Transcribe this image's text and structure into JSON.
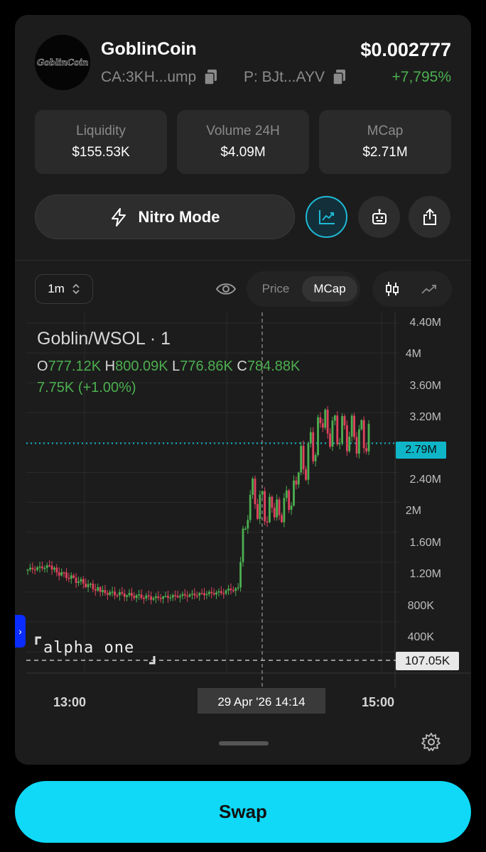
{
  "token": {
    "logo_text": "GoblinCoin",
    "name": "GoblinCoin",
    "contract": "CA:3KH...ump",
    "pair": "P: BJt...AYV",
    "price": "$0.002777",
    "change": "+7,795%"
  },
  "stats": [
    {
      "label": "Liquidity",
      "value": "$155.53K"
    },
    {
      "label": "Volume 24H",
      "value": "$4.09M"
    },
    {
      "label": "MCap",
      "value": "$2.71M"
    }
  ],
  "actions": {
    "nitro_label": "Nitro Mode",
    "chart_icon": "trending-chart-icon",
    "bot_icon": "bot-icon",
    "share_icon": "share-icon"
  },
  "toolbar": {
    "interval": "1m",
    "eye_icon": "eye-icon",
    "price_option": "Price",
    "mcap_option": "MCap",
    "candles_icon": "candlestick-icon",
    "line_icon": "line-chart-icon"
  },
  "legend": {
    "title": "Goblin/WSOL · 1",
    "o_label": "O",
    "o_value": "777.12K",
    "h_label": "H",
    "h_value": "800.09K",
    "l_label": "L",
    "l_value": "776.86K",
    "c_label": "C",
    "c_value": "784.88K",
    "change": "7.75K (+1.00%)"
  },
  "chart_data": {
    "type": "candlestick",
    "y_axis_ticks": [
      "4.40M",
      "4M",
      "3.60M",
      "3.20M",
      "2.40M",
      "2M",
      "1.60M",
      "1.20M",
      "800K",
      "400K"
    ],
    "ylim": [
      0,
      4400000
    ],
    "x_axis_ticks": [
      "13:00",
      "15:00"
    ],
    "crosshair_time": "29 Apr '26   14:14",
    "current_value_label": "2.79M",
    "current_value": 2790000,
    "low_line_label": "107.05K",
    "low_line_value": 107050,
    "colors": {
      "up": "#4caf50",
      "down": "#e0435e",
      "accent": "#0fb6c8"
    },
    "grid": true
  },
  "watermark": "alpha one",
  "side_tab_glyph": "›",
  "footer": {
    "settings_icon": "gear-icon"
  },
  "swap_label": "Swap"
}
